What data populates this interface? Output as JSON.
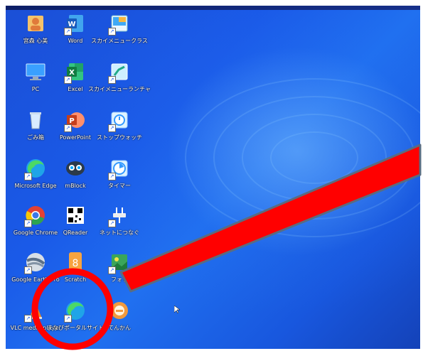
{
  "desktop_icons": [
    {
      "name": "user-folder-icon",
      "label": "宮森 心美"
    },
    {
      "name": "word-icon",
      "label": "Word"
    },
    {
      "name": "skymenu-class-icon",
      "label": "スカイメニュークラス"
    },
    {
      "name": "pc-icon",
      "label": "PC"
    },
    {
      "name": "excel-icon",
      "label": "Excel"
    },
    {
      "name": "skymenu-launcher-icon",
      "label": "スカイメニューランチャ"
    },
    {
      "name": "recycle-bin-icon",
      "label": "ごみ箱"
    },
    {
      "name": "powerpoint-icon",
      "label": "PowerPoint"
    },
    {
      "name": "stop-watch-icon",
      "label": "ストップウォッチ"
    },
    {
      "name": "edge-icon",
      "label": "Microsoft Edge"
    },
    {
      "name": "mblock-icon",
      "label": "mBlock"
    },
    {
      "name": "timer-icon",
      "label": "タイマー"
    },
    {
      "name": "chrome-icon",
      "label": "Google Chrome"
    },
    {
      "name": "qr-reader-icon",
      "label": "QReader"
    },
    {
      "name": "network-icon",
      "label": "ネットにつなぐ"
    },
    {
      "name": "google-earth-icon",
      "label": "Google Earth Pro"
    },
    {
      "name": "scratch-icon",
      "label": "Scratch"
    },
    {
      "name": "photo-icon",
      "label": "フォト"
    },
    {
      "name": "vlc-icon",
      "label": "VLC media player"
    },
    {
      "name": "manabi-portal-icon",
      "label": "まなびポータルサイト"
    },
    {
      "name": "tenkan-icon",
      "label": "てんかん"
    }
  ],
  "colors": {
    "annotation_red": "#ff0000",
    "desktop_blue": "#1a5ae8"
  }
}
